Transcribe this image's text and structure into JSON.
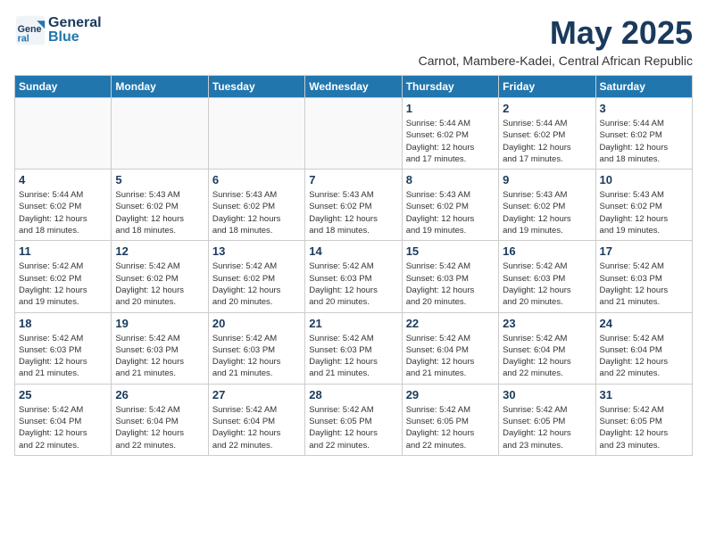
{
  "header": {
    "logo_general": "General",
    "logo_blue": "Blue",
    "month_title": "May 2025",
    "location": "Carnot, Mambere-Kadei, Central African Republic"
  },
  "weekdays": [
    "Sunday",
    "Monday",
    "Tuesday",
    "Wednesday",
    "Thursday",
    "Friday",
    "Saturday"
  ],
  "weeks": [
    [
      {
        "day": "",
        "info": ""
      },
      {
        "day": "",
        "info": ""
      },
      {
        "day": "",
        "info": ""
      },
      {
        "day": "",
        "info": ""
      },
      {
        "day": "1",
        "info": "Sunrise: 5:44 AM\nSunset: 6:02 PM\nDaylight: 12 hours\nand 17 minutes."
      },
      {
        "day": "2",
        "info": "Sunrise: 5:44 AM\nSunset: 6:02 PM\nDaylight: 12 hours\nand 17 minutes."
      },
      {
        "day": "3",
        "info": "Sunrise: 5:44 AM\nSunset: 6:02 PM\nDaylight: 12 hours\nand 18 minutes."
      }
    ],
    [
      {
        "day": "4",
        "info": "Sunrise: 5:44 AM\nSunset: 6:02 PM\nDaylight: 12 hours\nand 18 minutes."
      },
      {
        "day": "5",
        "info": "Sunrise: 5:43 AM\nSunset: 6:02 PM\nDaylight: 12 hours\nand 18 minutes."
      },
      {
        "day": "6",
        "info": "Sunrise: 5:43 AM\nSunset: 6:02 PM\nDaylight: 12 hours\nand 18 minutes."
      },
      {
        "day": "7",
        "info": "Sunrise: 5:43 AM\nSunset: 6:02 PM\nDaylight: 12 hours\nand 18 minutes."
      },
      {
        "day": "8",
        "info": "Sunrise: 5:43 AM\nSunset: 6:02 PM\nDaylight: 12 hours\nand 19 minutes."
      },
      {
        "day": "9",
        "info": "Sunrise: 5:43 AM\nSunset: 6:02 PM\nDaylight: 12 hours\nand 19 minutes."
      },
      {
        "day": "10",
        "info": "Sunrise: 5:43 AM\nSunset: 6:02 PM\nDaylight: 12 hours\nand 19 minutes."
      }
    ],
    [
      {
        "day": "11",
        "info": "Sunrise: 5:42 AM\nSunset: 6:02 PM\nDaylight: 12 hours\nand 19 minutes."
      },
      {
        "day": "12",
        "info": "Sunrise: 5:42 AM\nSunset: 6:02 PM\nDaylight: 12 hours\nand 20 minutes."
      },
      {
        "day": "13",
        "info": "Sunrise: 5:42 AM\nSunset: 6:02 PM\nDaylight: 12 hours\nand 20 minutes."
      },
      {
        "day": "14",
        "info": "Sunrise: 5:42 AM\nSunset: 6:03 PM\nDaylight: 12 hours\nand 20 minutes."
      },
      {
        "day": "15",
        "info": "Sunrise: 5:42 AM\nSunset: 6:03 PM\nDaylight: 12 hours\nand 20 minutes."
      },
      {
        "day": "16",
        "info": "Sunrise: 5:42 AM\nSunset: 6:03 PM\nDaylight: 12 hours\nand 20 minutes."
      },
      {
        "day": "17",
        "info": "Sunrise: 5:42 AM\nSunset: 6:03 PM\nDaylight: 12 hours\nand 21 minutes."
      }
    ],
    [
      {
        "day": "18",
        "info": "Sunrise: 5:42 AM\nSunset: 6:03 PM\nDaylight: 12 hours\nand 21 minutes."
      },
      {
        "day": "19",
        "info": "Sunrise: 5:42 AM\nSunset: 6:03 PM\nDaylight: 12 hours\nand 21 minutes."
      },
      {
        "day": "20",
        "info": "Sunrise: 5:42 AM\nSunset: 6:03 PM\nDaylight: 12 hours\nand 21 minutes."
      },
      {
        "day": "21",
        "info": "Sunrise: 5:42 AM\nSunset: 6:03 PM\nDaylight: 12 hours\nand 21 minutes."
      },
      {
        "day": "22",
        "info": "Sunrise: 5:42 AM\nSunset: 6:04 PM\nDaylight: 12 hours\nand 21 minutes."
      },
      {
        "day": "23",
        "info": "Sunrise: 5:42 AM\nSunset: 6:04 PM\nDaylight: 12 hours\nand 22 minutes."
      },
      {
        "day": "24",
        "info": "Sunrise: 5:42 AM\nSunset: 6:04 PM\nDaylight: 12 hours\nand 22 minutes."
      }
    ],
    [
      {
        "day": "25",
        "info": "Sunrise: 5:42 AM\nSunset: 6:04 PM\nDaylight: 12 hours\nand 22 minutes."
      },
      {
        "day": "26",
        "info": "Sunrise: 5:42 AM\nSunset: 6:04 PM\nDaylight: 12 hours\nand 22 minutes."
      },
      {
        "day": "27",
        "info": "Sunrise: 5:42 AM\nSunset: 6:04 PM\nDaylight: 12 hours\nand 22 minutes."
      },
      {
        "day": "28",
        "info": "Sunrise: 5:42 AM\nSunset: 6:05 PM\nDaylight: 12 hours\nand 22 minutes."
      },
      {
        "day": "29",
        "info": "Sunrise: 5:42 AM\nSunset: 6:05 PM\nDaylight: 12 hours\nand 22 minutes."
      },
      {
        "day": "30",
        "info": "Sunrise: 5:42 AM\nSunset: 6:05 PM\nDaylight: 12 hours\nand 23 minutes."
      },
      {
        "day": "31",
        "info": "Sunrise: 5:42 AM\nSunset: 6:05 PM\nDaylight: 12 hours\nand 23 minutes."
      }
    ]
  ]
}
